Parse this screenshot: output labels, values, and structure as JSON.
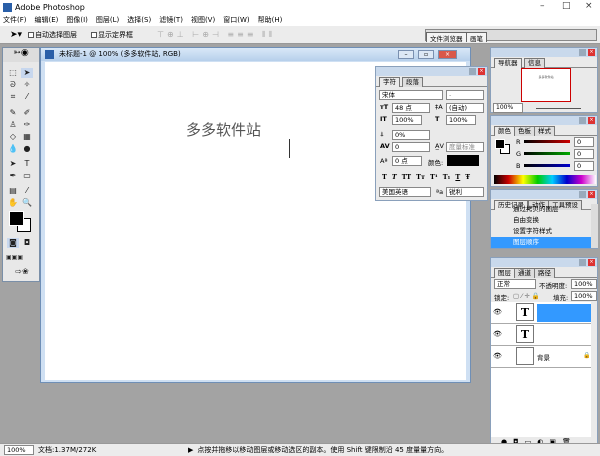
{
  "app": {
    "title": "Adobe Photoshop",
    "window_controls": [
      "–",
      "□",
      "×"
    ]
  },
  "menu": [
    "文件(F)",
    "编辑(E)",
    "图像(I)",
    "图层(L)",
    "选择(S)",
    "滤镜(T)",
    "视图(V)",
    "窗口(W)",
    "帮助(H)"
  ],
  "options": {
    "auto_select": "自动选择图层",
    "show_bounds": "显示定界框"
  },
  "palette_well": {
    "tabs": [
      "文件浏览器",
      "画笔"
    ]
  },
  "document": {
    "title": "未标题-1 @ 100% (多多软件站, RGB)",
    "canvas_text": "多多软件站"
  },
  "character": {
    "tabs": [
      "字符",
      "段落"
    ],
    "font": "宋体",
    "style": "-",
    "size": "48 点",
    "leading": "(自动)",
    "vscale": "100%",
    "hscale": "100%",
    "tracking_pct": "0%",
    "kerning": "0",
    "kerning_mode": "度量标准",
    "baseline": "0 点",
    "color_label": "颜色:",
    "style_buttons": [
      "T",
      "T",
      "TT",
      "Tт",
      "T¹",
      "T₁",
      "T",
      "Ŧ"
    ],
    "language": "美国英语",
    "aa_label": "ªa",
    "antialias": "锐利"
  },
  "navigator": {
    "tabs": [
      "导航器",
      "信息"
    ],
    "zoom": "100%",
    "thumb_text": "多多软件站"
  },
  "color": {
    "tabs": [
      "颜色",
      "色板",
      "样式"
    ],
    "channels": [
      {
        "name": "R",
        "value": "0",
        "color": "#cc0000"
      },
      {
        "name": "G",
        "value": "0",
        "color": "#00aa00"
      },
      {
        "name": "B",
        "value": "0",
        "color": "#0000cc"
      }
    ]
  },
  "history": {
    "tabs": [
      "历史记录",
      "动作",
      "工具预设"
    ],
    "items": [
      "通过拷贝的图层",
      "自由变换",
      "设置字符样式",
      "图层顺序"
    ],
    "selected": 3
  },
  "layers": {
    "tabs": [
      "图层",
      "通道",
      "路径"
    ],
    "blend": "正常",
    "opacity_label": "不透明度:",
    "opacity": "100%",
    "lock_label": "锁定:",
    "fill_label": "填充:",
    "fill": "100%",
    "items": [
      {
        "type": "T",
        "name": "",
        "selected": true
      },
      {
        "type": "T",
        "name": ""
      },
      {
        "type": "",
        "name": "背景"
      }
    ]
  },
  "status": {
    "zoom": "100%",
    "doc": "文档:1.37M/272K",
    "hint": "点按并拖移以移动图层或移动选区的副本。使用 Shift 键限制沿 45 度量量方向。"
  }
}
